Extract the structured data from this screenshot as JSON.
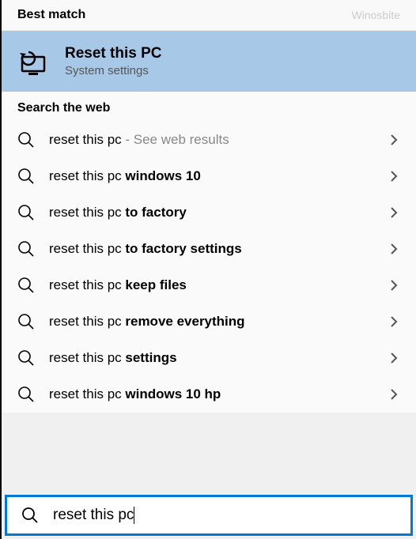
{
  "header": {
    "title": "Best match",
    "watermark": "Winosbite"
  },
  "best_match": {
    "title": "Reset this PC",
    "subtitle": "System settings"
  },
  "section_title": "Search the web",
  "results": [
    {
      "prefix": "reset this pc",
      "bold": "",
      "suffix": " - See web results"
    },
    {
      "prefix": "reset this pc ",
      "bold": "windows 10",
      "suffix": ""
    },
    {
      "prefix": "reset this pc ",
      "bold": "to factory",
      "suffix": ""
    },
    {
      "prefix": "reset this pc ",
      "bold": "to factory settings",
      "suffix": ""
    },
    {
      "prefix": "reset this pc ",
      "bold": "keep files",
      "suffix": ""
    },
    {
      "prefix": "reset this pc ",
      "bold": "remove everything",
      "suffix": ""
    },
    {
      "prefix": "reset this pc ",
      "bold": "settings",
      "suffix": ""
    },
    {
      "prefix": "reset this pc ",
      "bold": "windows 10 hp",
      "suffix": ""
    }
  ],
  "search_input": {
    "value": "reset this pc"
  }
}
